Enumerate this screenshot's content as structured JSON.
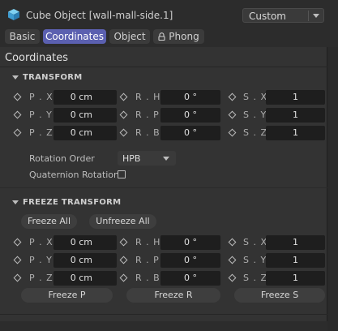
{
  "window": {
    "title": "Cube Object [wall-mall-side.1]",
    "preset": "Custom",
    "icon": "cube-icon"
  },
  "tabs": [
    {
      "label": "Basic",
      "active": false
    },
    {
      "label": "Coordinates",
      "active": true
    },
    {
      "label": "Object",
      "active": false
    },
    {
      "label": "Phong",
      "icon": "lock-icon",
      "active": false
    }
  ],
  "section_title": "Coordinates",
  "transform": {
    "title": "TRANSFORM",
    "rows": [
      {
        "p": {
          "label": "P . X",
          "value": "0 cm"
        },
        "r": {
          "label": "R . H",
          "value": "0 °"
        },
        "s": {
          "label": "S . X",
          "value": "1"
        }
      },
      {
        "p": {
          "label": "P . Y",
          "value": "0 cm"
        },
        "r": {
          "label": "R . P",
          "value": "0 °"
        },
        "s": {
          "label": "S . Y",
          "value": "1"
        }
      },
      {
        "p": {
          "label": "P . Z",
          "value": "0 cm"
        },
        "r": {
          "label": "R . B",
          "value": "0 °"
        },
        "s": {
          "label": "S . Z",
          "value": "1"
        }
      }
    ],
    "rotation_order_label": "Rotation Order",
    "rotation_order_value": "HPB",
    "quaternion_label": "Quaternion Rotation",
    "quaternion_checked": false
  },
  "freeze": {
    "title": "FREEZE TRANSFORM",
    "freeze_all": "Freeze All",
    "unfreeze_all": "Unfreeze All",
    "rows": [
      {
        "p": {
          "label": "P . X",
          "value": "0 cm"
        },
        "r": {
          "label": "R . H",
          "value": "0 °"
        },
        "s": {
          "label": "S . X",
          "value": "1"
        }
      },
      {
        "p": {
          "label": "P . Y",
          "value": "0 cm"
        },
        "r": {
          "label": "R . P",
          "value": "0 °"
        },
        "s": {
          "label": "S . Y",
          "value": "1"
        }
      },
      {
        "p": {
          "label": "P . Z",
          "value": "0 cm"
        },
        "r": {
          "label": "R . B",
          "value": "0 °"
        },
        "s": {
          "label": "S . Z",
          "value": "1"
        }
      }
    ],
    "freeze_p": "Freeze P",
    "freeze_r": "Freeze R",
    "freeze_s": "Freeze S"
  },
  "colors": {
    "accent": "#5b60b0",
    "background": "#2c2c2c",
    "panel": "#333333",
    "field": "#1e1e1e"
  }
}
